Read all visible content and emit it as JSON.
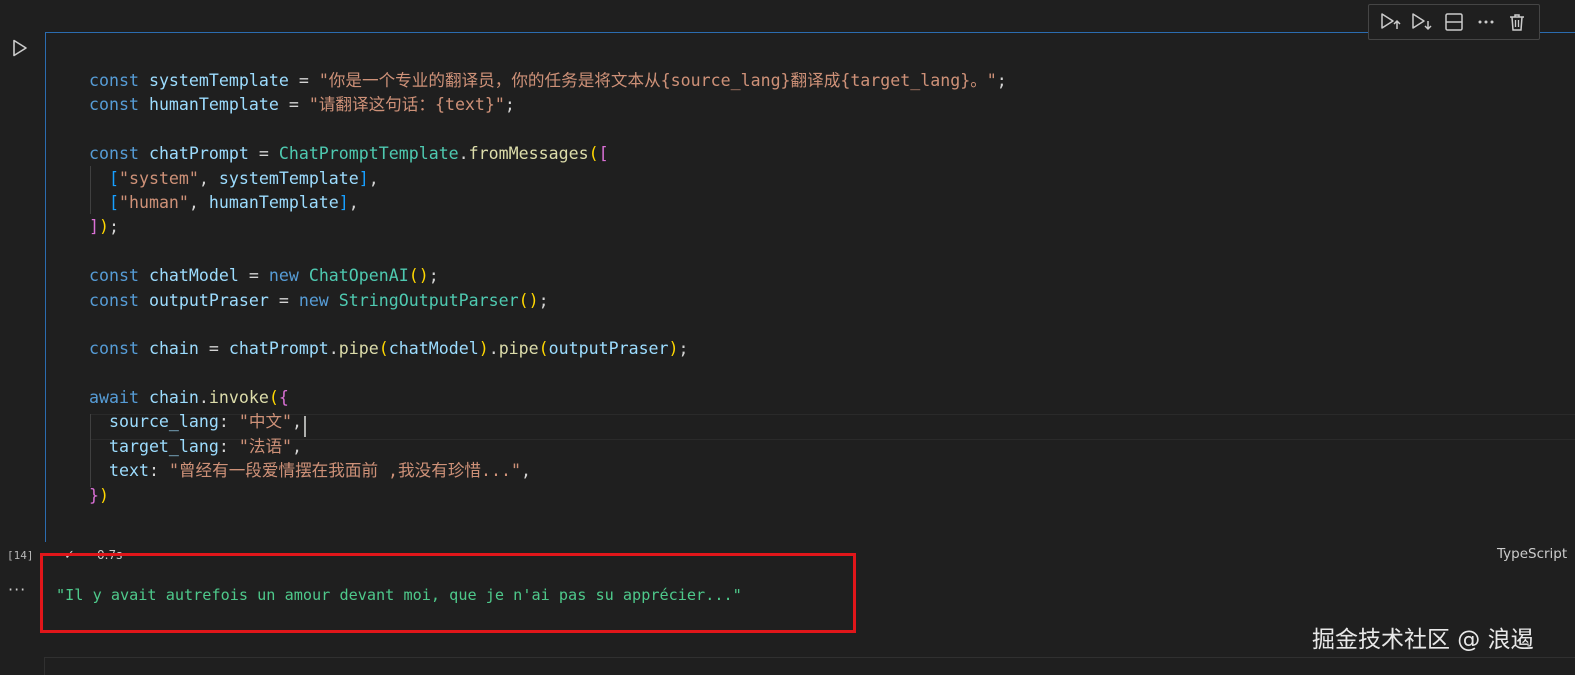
{
  "toolbar": {
    "icons": [
      "execute-above-icon",
      "execute-below-icon",
      "split-cell-icon",
      "more-icon",
      "delete-icon"
    ]
  },
  "code_lines": [
    [
      {
        "t": "const ",
        "c": "kw"
      },
      {
        "t": "systemTemplate",
        "c": "var"
      },
      {
        "t": " = ",
        "c": "pn"
      },
      {
        "t": "\"你是一个专业的翻译员，你的任务是将文本从{source_lang}翻译成{target_lang}。\"",
        "c": "str"
      },
      {
        "t": ";",
        "c": "pn"
      }
    ],
    [
      {
        "t": "const ",
        "c": "kw"
      },
      {
        "t": "humanTemplate",
        "c": "var"
      },
      {
        "t": " = ",
        "c": "pn"
      },
      {
        "t": "\"请翻译这句话：{text}\"",
        "c": "str"
      },
      {
        "t": ";",
        "c": "pn"
      }
    ],
    [],
    [
      {
        "t": "const ",
        "c": "kw"
      },
      {
        "t": "chatPrompt",
        "c": "var"
      },
      {
        "t": " = ",
        "c": "pn"
      },
      {
        "t": "ChatPromptTemplate",
        "c": "cls"
      },
      {
        "t": ".",
        "c": "pn"
      },
      {
        "t": "fromMessages",
        "c": "fn"
      },
      {
        "t": "(",
        "c": "b1"
      },
      {
        "t": "[",
        "c": "b2"
      }
    ],
    [
      {
        "t": "  ",
        "c": "pn"
      },
      {
        "t": "[",
        "c": "b3"
      },
      {
        "t": "\"system\"",
        "c": "str"
      },
      {
        "t": ", ",
        "c": "pn"
      },
      {
        "t": "systemTemplate",
        "c": "var"
      },
      {
        "t": "]",
        "c": "b3"
      },
      {
        "t": ",",
        "c": "pn"
      }
    ],
    [
      {
        "t": "  ",
        "c": "pn"
      },
      {
        "t": "[",
        "c": "b3"
      },
      {
        "t": "\"human\"",
        "c": "str"
      },
      {
        "t": ", ",
        "c": "pn"
      },
      {
        "t": "humanTemplate",
        "c": "var"
      },
      {
        "t": "]",
        "c": "b3"
      },
      {
        "t": ",",
        "c": "pn"
      }
    ],
    [
      {
        "t": "]",
        "c": "b2"
      },
      {
        "t": ")",
        "c": "b1"
      },
      {
        "t": ";",
        "c": "pn"
      }
    ],
    [],
    [
      {
        "t": "const ",
        "c": "kw"
      },
      {
        "t": "chatModel",
        "c": "var"
      },
      {
        "t": " = ",
        "c": "pn"
      },
      {
        "t": "new ",
        "c": "kw"
      },
      {
        "t": "ChatOpenAI",
        "c": "cls"
      },
      {
        "t": "()",
        "c": "b1"
      },
      {
        "t": ";",
        "c": "pn"
      }
    ],
    [
      {
        "t": "const ",
        "c": "kw"
      },
      {
        "t": "outputPraser",
        "c": "var"
      },
      {
        "t": " = ",
        "c": "pn"
      },
      {
        "t": "new ",
        "c": "kw"
      },
      {
        "t": "StringOutputParser",
        "c": "cls"
      },
      {
        "t": "()",
        "c": "b1"
      },
      {
        "t": ";",
        "c": "pn"
      }
    ],
    [],
    [
      {
        "t": "const ",
        "c": "kw"
      },
      {
        "t": "chain",
        "c": "var"
      },
      {
        "t": " = ",
        "c": "pn"
      },
      {
        "t": "chatPrompt",
        "c": "var"
      },
      {
        "t": ".",
        "c": "pn"
      },
      {
        "t": "pipe",
        "c": "fn"
      },
      {
        "t": "(",
        "c": "b1"
      },
      {
        "t": "chatModel",
        "c": "var"
      },
      {
        "t": ")",
        "c": "b1"
      },
      {
        "t": ".",
        "c": "pn"
      },
      {
        "t": "pipe",
        "c": "fn"
      },
      {
        "t": "(",
        "c": "b1"
      },
      {
        "t": "outputPraser",
        "c": "var"
      },
      {
        "t": ")",
        "c": "b1"
      },
      {
        "t": ";",
        "c": "pn"
      }
    ],
    [],
    [
      {
        "t": "await ",
        "c": "kw"
      },
      {
        "t": "chain",
        "c": "var"
      },
      {
        "t": ".",
        "c": "pn"
      },
      {
        "t": "invoke",
        "c": "fn"
      },
      {
        "t": "(",
        "c": "b1"
      },
      {
        "t": "{",
        "c": "b2"
      }
    ],
    [
      {
        "t": "  ",
        "c": "pn"
      },
      {
        "t": "source_lang",
        "c": "var"
      },
      {
        "t": ": ",
        "c": "pn"
      },
      {
        "t": "\"中文\"",
        "c": "str"
      },
      {
        "t": ",",
        "c": "pn"
      }
    ],
    [
      {
        "t": "  ",
        "c": "pn"
      },
      {
        "t": "target_lang",
        "c": "var"
      },
      {
        "t": ": ",
        "c": "pn"
      },
      {
        "t": "\"法语\"",
        "c": "str"
      },
      {
        "t": ",",
        "c": "pn"
      }
    ],
    [
      {
        "t": "  ",
        "c": "pn"
      },
      {
        "t": "text",
        "c": "var"
      },
      {
        "t": ": ",
        "c": "pn"
      },
      {
        "t": "\"曾经有一段爱情摆在我面前 ,我没有珍惜...\"",
        "c": "str"
      },
      {
        "t": ",",
        "c": "pn"
      }
    ],
    [
      {
        "t": "}",
        "c": "b2"
      },
      {
        "t": ")",
        "c": "b1"
      }
    ]
  ],
  "cell": {
    "execution_count": "[14]",
    "status_check": "✓",
    "duration": "0.7s",
    "language": "TypeScript"
  },
  "output": {
    "menu": "···",
    "text": "\"Il y avait autrefois un amour devant moi, que je n'ai pas su apprécier...\""
  },
  "watermark": "掘金技术社区 @ 浪遏"
}
